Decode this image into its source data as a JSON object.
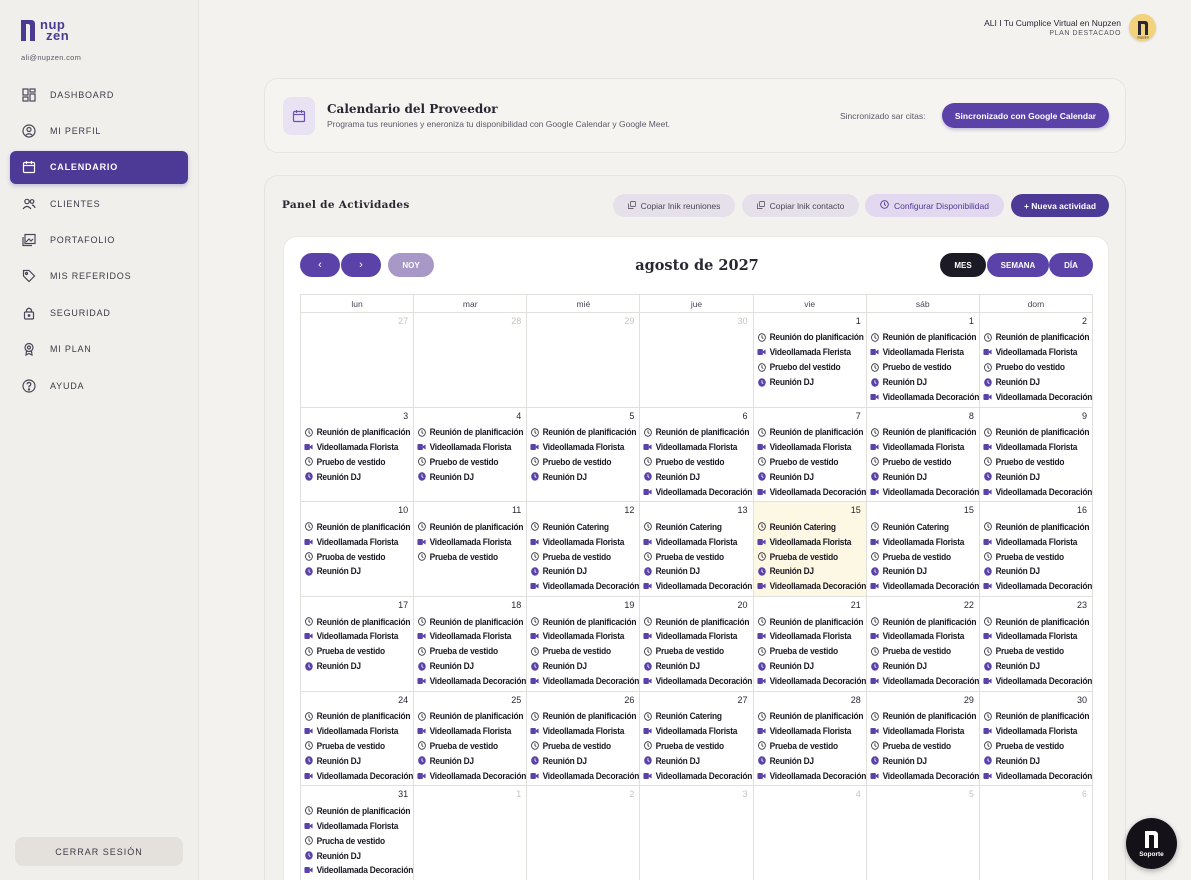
{
  "sidebar": {
    "logo_line1": "nup",
    "logo_line2": "zen",
    "email": "ali@nupzen.com",
    "items": [
      {
        "label": "DASHBOARD",
        "icon": "dashboard-icon",
        "active": false
      },
      {
        "label": "MI PERFIL",
        "icon": "user-icon",
        "active": false
      },
      {
        "label": "CALENDARIO",
        "icon": "calendar-icon",
        "active": true
      },
      {
        "label": "CLIENTES",
        "icon": "users-icon",
        "active": false
      },
      {
        "label": "PORTAFOLIO",
        "icon": "portfolio-icon",
        "active": false
      },
      {
        "label": "MIS REFERIDOS",
        "icon": "tag-icon",
        "active": false
      },
      {
        "label": "SEGURIDAD",
        "icon": "lock-icon",
        "active": false
      },
      {
        "label": "MI PLAN",
        "icon": "badge-icon",
        "active": false
      },
      {
        "label": "AYUDA",
        "icon": "help-icon",
        "active": false
      }
    ],
    "logout_label": "CERRAR SESIÓN"
  },
  "topbar": {
    "title": "ALI I Tu Cumplice Virtual en Nupzen",
    "plan": "PLAN DESTACADO",
    "avatar_text": "nupzen"
  },
  "provider": {
    "title": "Calendario del Proveedor",
    "subtitle": "Programa tus reuniones y eneroniza tu disponibilidad con Google Calendar y Google Meet.",
    "sync_label": "Sincronizado sar citas:",
    "sync_button": "Sincronizado con Google Calendar"
  },
  "activities": {
    "title": "Panel de Actividades",
    "buttons": {
      "copy_meetings": "Copiar lnik reuniones",
      "copy_contact": "Copiar lnik contacto",
      "availability": "Configurar Disponibilidad",
      "new_activity": "+ Nueva actividad"
    }
  },
  "calendar": {
    "title": "agosto de 2027",
    "prev": "‹",
    "next": "›",
    "today": "NOY",
    "views": {
      "month": "MES",
      "week": "SEMANA",
      "day": "DÍA"
    },
    "weekdays": [
      "lun",
      "mar",
      "mié",
      "jue",
      "vie",
      "sáb",
      "dom"
    ],
    "weeks": [
      [
        {
          "day": "27",
          "muted": true,
          "events": []
        },
        {
          "day": "28",
          "muted": true,
          "events": []
        },
        {
          "day": "29",
          "muted": true,
          "events": []
        },
        {
          "day": "30",
          "muted": true,
          "events": []
        },
        {
          "day": "1",
          "events": [
            [
              "c",
              "Reunión do planificación"
            ],
            [
              "v",
              "Videollamada Flerista"
            ],
            [
              "c",
              "Pruebo del vestido"
            ],
            [
              "f",
              "Reunión DJ"
            ]
          ]
        },
        {
          "day": "1",
          "events": [
            [
              "c",
              "Reunión de planificación"
            ],
            [
              "v",
              "Videollamada Flerista"
            ],
            [
              "c",
              "Pruebo de vestido"
            ],
            [
              "f",
              "Reunión DJ"
            ],
            [
              "v",
              "Videollamada Decoración"
            ]
          ]
        },
        {
          "day": "2",
          "events": [
            [
              "c",
              "Reunión de planificación"
            ],
            [
              "v",
              "Videollamada Florista"
            ],
            [
              "c",
              "Pruebo do vestido"
            ],
            [
              "f",
              "Reunión DJ"
            ],
            [
              "v",
              "Videollamada Decoración"
            ]
          ]
        }
      ],
      [
        {
          "day": "3",
          "events": [
            [
              "c",
              "Reunión de planificación"
            ],
            [
              "v",
              "Videollamada Florista"
            ],
            [
              "c",
              "Pruebo de vestido"
            ],
            [
              "f",
              "Reunión DJ"
            ]
          ]
        },
        {
          "day": "4",
          "events": [
            [
              "c",
              "Reunión de planificación"
            ],
            [
              "v",
              "Videollamada Florista"
            ],
            [
              "c",
              "Pruebo de vestido"
            ],
            [
              "f",
              "Reunión DJ"
            ]
          ]
        },
        {
          "day": "5",
          "events": [
            [
              "c",
              "Reunión de planificación"
            ],
            [
              "v",
              "Videollamada Florista"
            ],
            [
              "c",
              "Pruebo de vestido"
            ],
            [
              "f",
              "Reunión DJ"
            ]
          ]
        },
        {
          "day": "6",
          "events": [
            [
              "c",
              "Reunión de planificación"
            ],
            [
              "v",
              "Videollamada Florista"
            ],
            [
              "c",
              "Pruebo de vestido"
            ],
            [
              "f",
              "Reunión DJ"
            ],
            [
              "v",
              "Videollamada Decoración"
            ]
          ]
        },
        {
          "day": "7",
          "events": [
            [
              "c",
              "Reunión de planificación"
            ],
            [
              "v",
              "Videollamada Florista"
            ],
            [
              "c",
              "Pruebo de vestido"
            ],
            [
              "f",
              "Reunión DJ"
            ],
            [
              "v",
              "Videollamada Decoración"
            ]
          ]
        },
        {
          "day": "8",
          "events": [
            [
              "c",
              "Reunión de planificación"
            ],
            [
              "v",
              "Videollamada Florista"
            ],
            [
              "c",
              "Pruebo de vestido"
            ],
            [
              "f",
              "Reunión DJ"
            ],
            [
              "v",
              "Videollamada Decoración"
            ]
          ]
        },
        {
          "day": "9",
          "events": [
            [
              "c",
              "Reunión de planificación"
            ],
            [
              "v",
              "Videollamada Florista"
            ],
            [
              "c",
              "Pruebo de vestido"
            ],
            [
              "f",
              "Reunión DJ"
            ],
            [
              "v",
              "Videollamada Decoración"
            ]
          ]
        }
      ],
      [
        {
          "day": "10",
          "events": [
            [
              "c",
              "Reunión de planificación"
            ],
            [
              "v",
              "Videollamada Florista"
            ],
            [
              "c",
              "Pruoba de vestido"
            ],
            [
              "f",
              "Reunión DJ"
            ]
          ]
        },
        {
          "day": "11",
          "events": [
            [
              "c",
              "Reunión de planificación"
            ],
            [
              "v",
              "Videollamada Florista"
            ],
            [
              "c",
              "Prueba de vestido"
            ]
          ]
        },
        {
          "day": "12",
          "events": [
            [
              "c",
              "Reunión Catering"
            ],
            [
              "v",
              "Videollamada Florista"
            ],
            [
              "c",
              "Prueba de vestido"
            ],
            [
              "f",
              "Reunión DJ"
            ],
            [
              "v",
              "Videollamada Decoración"
            ]
          ]
        },
        {
          "day": "13",
          "events": [
            [
              "c",
              "Reunión Catering"
            ],
            [
              "v",
              "Videollamada Florista"
            ],
            [
              "c",
              "Prueba de vestido"
            ],
            [
              "f",
              "Reunión DJ"
            ],
            [
              "v",
              "Videollamada Decoración"
            ]
          ]
        },
        {
          "day": "15",
          "today": true,
          "events": [
            [
              "c",
              "Reunión Catering"
            ],
            [
              "v",
              "Videollamada Florista"
            ],
            [
              "c",
              "Prueba de vestido"
            ],
            [
              "f",
              "Reunión DJ"
            ],
            [
              "v",
              "Videollamada Decoración"
            ]
          ]
        },
        {
          "day": "15",
          "events": [
            [
              "c",
              "Reunión Catering"
            ],
            [
              "v",
              "Videollamada Florista"
            ],
            [
              "c",
              "Prueba de vestido"
            ],
            [
              "f",
              "Reunión DJ"
            ],
            [
              "v",
              "Videollamada Decoración"
            ]
          ]
        },
        {
          "day": "16",
          "events": [
            [
              "c",
              "Reunión de planificación"
            ],
            [
              "v",
              "Videollamada Florista"
            ],
            [
              "c",
              "Prueba de vestido"
            ],
            [
              "f",
              "Reunión DJ"
            ],
            [
              "v",
              "Videollamada Decoración"
            ]
          ]
        }
      ],
      [
        {
          "day": "17",
          "events": [
            [
              "c",
              "Reunión de planificación"
            ],
            [
              "v",
              "Videollamada Florista"
            ],
            [
              "c",
              "Prueba de vestido"
            ],
            [
              "f",
              "Reunión DJ"
            ]
          ]
        },
        {
          "day": "18",
          "events": [
            [
              "c",
              "Reunión de planificación"
            ],
            [
              "v",
              "Videollamada Florista"
            ],
            [
              "c",
              "Prueba de vestido"
            ],
            [
              "f",
              "Reunión DJ"
            ],
            [
              "v",
              "Videollamada Decoración"
            ]
          ]
        },
        {
          "day": "19",
          "events": [
            [
              "c",
              "Reunión de planificación"
            ],
            [
              "v",
              "Videollamada Florista"
            ],
            [
              "c",
              "Prueba de vestido"
            ],
            [
              "f",
              "Reunión DJ"
            ],
            [
              "v",
              "Videollamada Decoración"
            ]
          ]
        },
        {
          "day": "20",
          "events": [
            [
              "c",
              "Reunión de planificación"
            ],
            [
              "v",
              "Videollamada Florista"
            ],
            [
              "c",
              "Prueba de vestido"
            ],
            [
              "f",
              "Reunión DJ"
            ],
            [
              "v",
              "Videollamada Decoración"
            ]
          ]
        },
        {
          "day": "21",
          "events": [
            [
              "c",
              "Reunión de planificación"
            ],
            [
              "v",
              "Videollamada Florista"
            ],
            [
              "c",
              "Prueba de vestido"
            ],
            [
              "f",
              "Reunión DJ"
            ],
            [
              "v",
              "Videollamada Decoración"
            ]
          ]
        },
        {
          "day": "22",
          "events": [
            [
              "c",
              "Reunión de planificación"
            ],
            [
              "v",
              "Videollamada Florista"
            ],
            [
              "c",
              "Prueba de vestido"
            ],
            [
              "f",
              "Reunión DJ"
            ],
            [
              "v",
              "Videollamada Decoración"
            ]
          ]
        },
        {
          "day": "23",
          "events": [
            [
              "c",
              "Reunión de planificación"
            ],
            [
              "v",
              "Videollamada Florista"
            ],
            [
              "c",
              "Prueba de vestido"
            ],
            [
              "f",
              "Reunión DJ"
            ],
            [
              "v",
              "Videollamada Decoración"
            ]
          ]
        }
      ],
      [
        {
          "day": "24",
          "events": [
            [
              "c",
              "Reunión de planificación"
            ],
            [
              "v",
              "Videollamada Florista"
            ],
            [
              "c",
              "Prueba de vestido"
            ],
            [
              "f",
              "Reunión DJ"
            ],
            [
              "v",
              "Videollamada Decoración"
            ]
          ]
        },
        {
          "day": "25",
          "events": [
            [
              "c",
              "Reunión de planificación"
            ],
            [
              "v",
              "Videollamada Florista"
            ],
            [
              "c",
              "Prueba de vestido"
            ],
            [
              "f",
              "Reunión DJ"
            ],
            [
              "v",
              "Videollamada Decoración"
            ]
          ]
        },
        {
          "day": "26",
          "events": [
            [
              "c",
              "Reunión de planificación"
            ],
            [
              "v",
              "Videollamada Florista"
            ],
            [
              "c",
              "Prueba de vestido"
            ],
            [
              "f",
              "Reunión DJ"
            ],
            [
              "v",
              "Videollamada Decoración"
            ]
          ]
        },
        {
          "day": "27",
          "events": [
            [
              "c",
              "Reunión Catering"
            ],
            [
              "v",
              "Videollamada Florista"
            ],
            [
              "c",
              "Prueba de vestido"
            ],
            [
              "f",
              "Reunión DJ"
            ],
            [
              "v",
              "Videollamada Decoración"
            ]
          ]
        },
        {
          "day": "28",
          "events": [
            [
              "c",
              "Reunión de planificación"
            ],
            [
              "v",
              "Videollamada Florista"
            ],
            [
              "c",
              "Prueba de vestido"
            ],
            [
              "f",
              "Reunión DJ"
            ],
            [
              "v",
              "Videollamada Decoración"
            ]
          ]
        },
        {
          "day": "29",
          "events": [
            [
              "c",
              "Reunión de planificación"
            ],
            [
              "v",
              "Videollamada Florista"
            ],
            [
              "c",
              "Prueba de vestido"
            ],
            [
              "f",
              "Reunión DJ"
            ],
            [
              "v",
              "Videollamada Decoración"
            ]
          ]
        },
        {
          "day": "30",
          "events": [
            [
              "c",
              "Reunión de planificación"
            ],
            [
              "v",
              "Videollamada Florista"
            ],
            [
              "c",
              "Prueba de vestido"
            ],
            [
              "f",
              "Reunión DJ"
            ],
            [
              "v",
              "Videollamada Decoración"
            ]
          ]
        }
      ],
      [
        {
          "day": "31",
          "events": [
            [
              "c",
              "Reunión de planificación"
            ],
            [
              "v",
              "Videollamada Florista"
            ],
            [
              "c",
              "Prucha de vestido"
            ],
            [
              "f",
              "Reunión DJ"
            ],
            [
              "v",
              "Videollamada Decoración"
            ]
          ]
        },
        {
          "day": "1",
          "muted": true,
          "events": []
        },
        {
          "day": "2",
          "muted": true,
          "events": []
        },
        {
          "day": "3",
          "muted": true,
          "events": []
        },
        {
          "day": "4",
          "muted": true,
          "events": []
        },
        {
          "day": "5",
          "muted": true,
          "events": []
        },
        {
          "day": "6",
          "muted": true,
          "events": []
        }
      ]
    ]
  },
  "support": {
    "label": "Soporte"
  },
  "colors": {
    "accent": "#4d3a96",
    "today_bg": "#fdf8e4"
  }
}
